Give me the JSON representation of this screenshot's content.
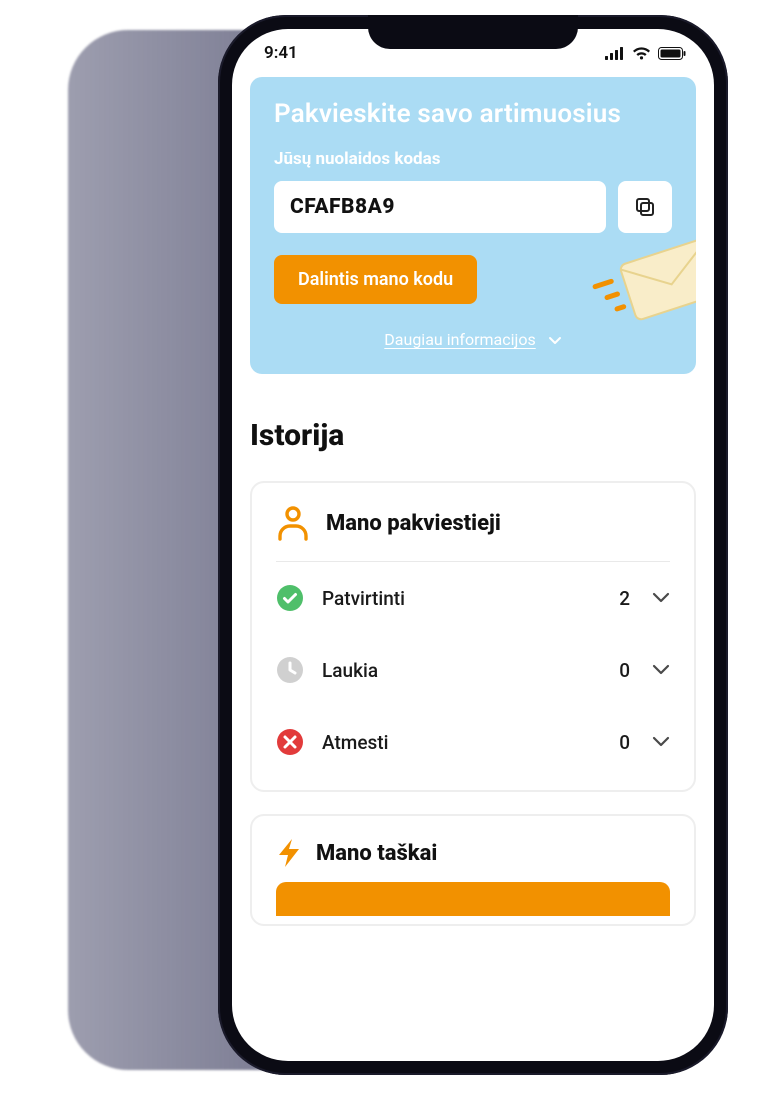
{
  "status": {
    "time": "9:41"
  },
  "invite": {
    "title": "Pakvieskite savo artimuosius",
    "subtitle": "Jūsų nuolaidos kodas",
    "code": "CFAFB8A9",
    "share_label": "Dalintis mano kodu",
    "more_info": "Daugiau informacijos"
  },
  "history": {
    "title": "Istorija",
    "invited": {
      "title": "Mano pakviestieji",
      "rows": [
        {
          "label": "Patvirtinti",
          "count": "2"
        },
        {
          "label": "Laukia",
          "count": "0"
        },
        {
          "label": "Atmesti",
          "count": "0"
        }
      ]
    },
    "points": {
      "title": "Mano taškai"
    }
  }
}
